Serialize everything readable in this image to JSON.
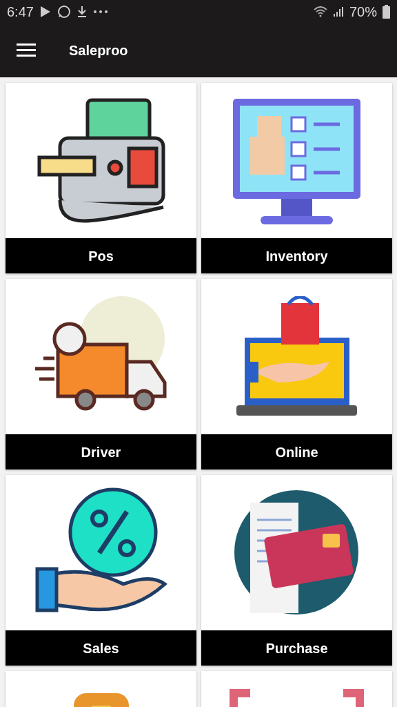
{
  "status_bar": {
    "time": "6:47",
    "battery": "70%"
  },
  "app_bar": {
    "title": "Saleproo"
  },
  "tiles": [
    {
      "kind": "pos",
      "label": "Pos"
    },
    {
      "kind": "inventory",
      "label": "Inventory"
    },
    {
      "kind": "driver",
      "label": "Driver"
    },
    {
      "kind": "online",
      "label": "Online"
    },
    {
      "kind": "sales",
      "label": "Sales"
    },
    {
      "kind": "purchase",
      "label": "Purchase"
    },
    {
      "kind": "wallet"
    },
    {
      "kind": "barcode"
    }
  ]
}
